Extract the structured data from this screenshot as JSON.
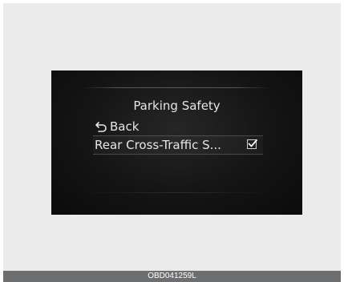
{
  "menu": {
    "title": "Parking Safety",
    "items": [
      {
        "label": "Back",
        "icon": "back-arrow-icon"
      },
      {
        "label": "Rear Cross-Traffic S...",
        "checked": true,
        "icon": "checkbox-checked-icon"
      }
    ]
  },
  "caption": {
    "code": "OBD041259L"
  },
  "colors": {
    "screen_bg": "#141414",
    "text": "#e6e6e6",
    "frame_bg": "#ebebeb",
    "caption_bg": "#6d6e70"
  }
}
